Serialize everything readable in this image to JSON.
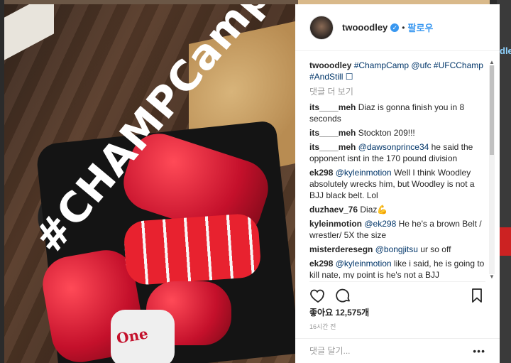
{
  "photo": {
    "overlay_text": "#CHAMPCamp",
    "wrap_text": "One"
  },
  "edge": {
    "text": "dle"
  },
  "post": {
    "author": "twooodley",
    "verified_icon": "verified-badge",
    "separator": "•",
    "follow_label": "팔로우",
    "caption": {
      "user": "twooodley",
      "text": "#ChampCamp @ufc #UFCChamp #AndStill ☐"
    },
    "view_more": "댓글 더 보기",
    "comments": [
      {
        "user": "its____meh",
        "text": "Diaz is gonna finish you in 8 seconds"
      },
      {
        "user": "its____meh",
        "text": "Stockton 209!!!"
      },
      {
        "user": "its____meh",
        "mention": "@dawsonprince34",
        "text": " he said the opponent isnt in the 170 pound division"
      },
      {
        "user": "ek298",
        "mention": "@kyleinmotion",
        "text": " Well I think Woodley absolutely wrecks him, but Woodley is not a BJJ black belt. Lol"
      },
      {
        "user": "duzhaev_76",
        "text": "Diaz💪"
      },
      {
        "user": "kyleinmotion",
        "mention": "@ek298",
        "text": " He he's a brown Belt / wrestler/ 5X the size"
      },
      {
        "user": "misterderesegn",
        "mention": "@bongjitsu",
        "text": " ur so off"
      },
      {
        "user": "ek298",
        "mention": "@kyleinmotion",
        "text": " like i said, he is going to kill nate, my point is he's not a BJJ"
      }
    ],
    "likes": "좋아요 12,575개",
    "timestamp": "16시간 전",
    "comment_placeholder": "댓글 달기...",
    "more_label": "•••",
    "icons": [
      "heart-icon",
      "comment-icon",
      "bookmark-icon",
      "more-icon"
    ]
  }
}
